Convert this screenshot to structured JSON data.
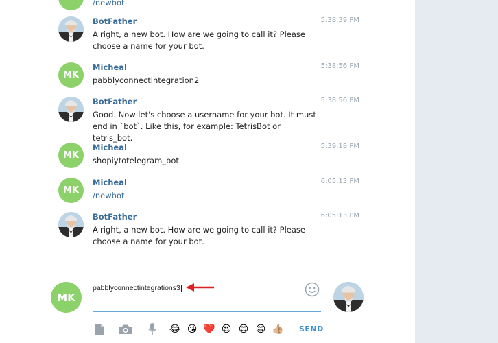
{
  "messages": [
    {
      "sender": "",
      "text": "/newbot",
      "time": "",
      "avatar": "MK",
      "type": "user-partial"
    },
    {
      "sender": "BotFather",
      "time": "5:38:39 PM",
      "text": "Alright, a new bot. How are we going to call it? Please choose a name for your bot.",
      "avatar": "bot"
    },
    {
      "sender": "Micheal",
      "time": "5:38:56 PM",
      "text": "pabblyconnectintegration2",
      "avatar": "MK"
    },
    {
      "sender": "BotFather",
      "time": "5:38:56 PM",
      "text": "Good. Now let's choose a username for your bot. It must end in `bot`. Like this, for example: TetrisBot or tetris_bot.",
      "avatar": "bot"
    },
    {
      "sender": "Micheal",
      "time": "5:39:18 PM",
      "text": "shopiytotelegram_bot",
      "avatar": "MK"
    },
    {
      "sender": "Micheal",
      "time": "6:05:13 PM",
      "text": "/newbot",
      "avatar": "MK"
    },
    {
      "sender": "BotFather",
      "time": "6:05:13 PM",
      "text": "Alright, a new bot. How are we going to call it? Please choose a name for your bot.",
      "avatar": "bot"
    }
  ],
  "user_initials": "MK",
  "composer": {
    "value": "pabblyconnectintegrations3",
    "send_label": "SEND"
  },
  "toolbar": {
    "icons": [
      "file-icon",
      "camera-icon",
      "microphone-icon"
    ],
    "emojis": [
      "😂",
      "😘",
      "❤️",
      "😍",
      "😊",
      "😁",
      "👍🏼"
    ]
  },
  "colors": {
    "accent": "#3a6d99",
    "avatar_green": "#8dd16a",
    "send": "#3a8fd0",
    "arrow": "#e02020"
  }
}
